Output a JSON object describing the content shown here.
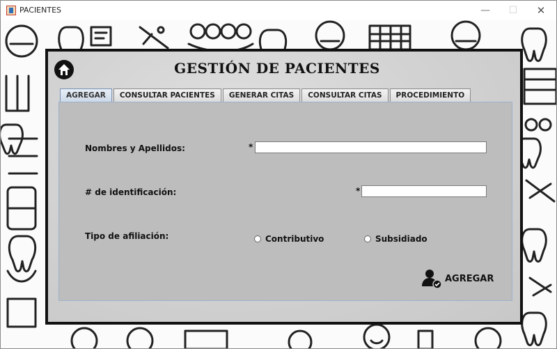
{
  "window": {
    "title": "PACIENTES",
    "controls": {
      "minimize": "—",
      "maximize": "☐",
      "close": "✕"
    }
  },
  "header": {
    "title": "GESTIÓN DE PACIENTES",
    "home_icon": "home-icon"
  },
  "tabs": [
    {
      "label": "AGREGAR",
      "active": true
    },
    {
      "label": "CONSULTAR PACIENTES",
      "active": false
    },
    {
      "label": "GENERAR CITAS",
      "active": false
    },
    {
      "label": "CONSULTAR CITAS",
      "active": false
    },
    {
      "label": "PROCEDIMIENTO",
      "active": false
    }
  ],
  "form": {
    "name_label": "Nombres y Apellidos:",
    "name_required": "*",
    "name_value": "",
    "id_label": "# de identificación:",
    "id_required": "*",
    "id_value": "",
    "affiliation_label": "Tipo de afiliación:",
    "affiliation_options": [
      "Contributivo",
      "Subsidiado"
    ],
    "submit_label": "AGREGAR",
    "submit_icon": "add-user-icon"
  },
  "colors": {
    "panel_border": "#111111",
    "content_bg": "#bdbdbd",
    "active_tab": "#cdd9e7"
  }
}
